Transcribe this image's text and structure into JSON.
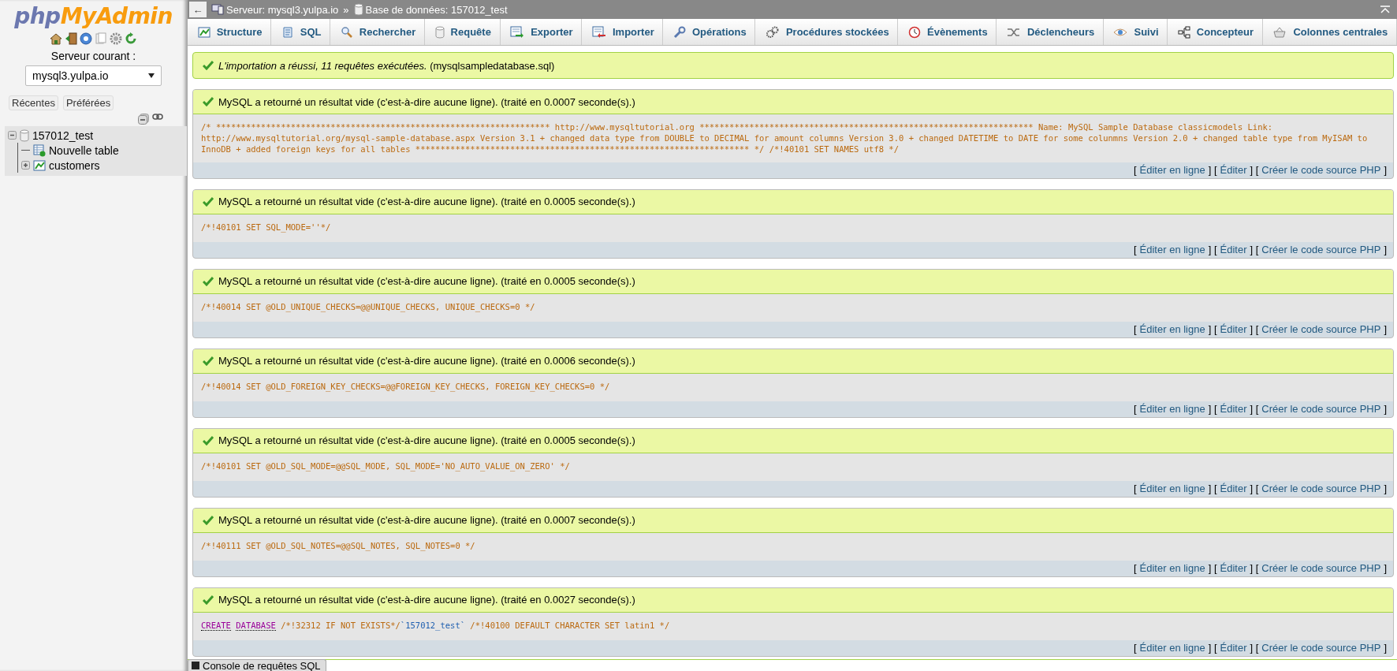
{
  "sidebar": {
    "logo": {
      "prefix": "php",
      "suffix": "MyAdmin"
    },
    "server_label": "Serveur courant :",
    "server_select": {
      "value": "mysql3.yulpa.io"
    },
    "buttons": [
      "Récentes",
      "Préférées"
    ],
    "tree": [
      {
        "label": "157012_test",
        "kind": "database",
        "expanded": true,
        "children": [
          {
            "label": "Nouvelle table",
            "kind": "new"
          },
          {
            "label": "customers",
            "kind": "table",
            "expanded": false
          }
        ]
      }
    ]
  },
  "back_button": "←",
  "breadcrumb": [
    {
      "kind": "server",
      "text": "Serveur: mysql3.yulpa.io"
    },
    {
      "kind": "separator",
      "text": "»"
    },
    {
      "kind": "database",
      "text": "Base de données: 157012_test"
    }
  ],
  "tabs": [
    {
      "label": "Structure",
      "selected": false
    },
    {
      "label": "SQL",
      "selected": false
    },
    {
      "label": "Rechercher",
      "selected": false
    },
    {
      "label": "Requête",
      "selected": false
    },
    {
      "label": "Exporter",
      "selected": false
    },
    {
      "label": "Importer",
      "selected": false
    },
    {
      "label": "Opérations",
      "selected": false
    },
    {
      "label": "Procédures stockées",
      "selected": false
    },
    {
      "label": "Évènements",
      "selected": false
    },
    {
      "label": "Déclencheurs",
      "selected": false
    },
    {
      "label": "Suivi",
      "selected": false
    },
    {
      "label": "Concepteur",
      "selected": false
    },
    {
      "label": "Colonnes centrales",
      "selected": false
    }
  ],
  "import_message": "*L'importation a réussi, 11 requêtes exécutées.* (mysqlsampledatabase.sql)",
  "results": [
    {
      "message": "MySQL a retourné un résultat vide (c'est-à-dire aucune ligne). (traité en 0.0007 seconde(s).)",
      "query": [
        {
          "kind": "comment",
          "text": "/* ******************************************************************* http://www.mysqltutorial.org ******************************************************************* Name: MySQL Sample Database classicmodels Link: http://www.mysqltutorial.org/mysql-sample-database.aspx Version 3.1 + changed data type from DOUBLE to DECIMAL for amount columns Version 3.0 + changed DATETIME to DATE for some colunmns Version 2.0 + changed table type from MyISAM to InnoDB + added foreign keys for all tables ******************************************************************* */ /*!40101 SET NAMES utf8 */"
        }
      ],
      "links": [
        {
          "kind": "bracket",
          "text": "["
        },
        {
          "kind": "link",
          "text": "Éditer en ligne"
        },
        {
          "kind": "bracket",
          "text": "] ["
        },
        {
          "kind": "link",
          "text": "Éditer"
        },
        {
          "kind": "bracket",
          "text": "] ["
        },
        {
          "kind": "link",
          "text": "Créer le code source PHP"
        },
        {
          "kind": "bracket",
          "text": "]"
        }
      ]
    },
    {
      "message": "MySQL a retourné un résultat vide (c'est-à-dire aucune ligne). (traité en 0.0005 seconde(s).)",
      "query": [
        {
          "kind": "comment",
          "text": "/*!40101 SET SQL_MODE=''*/"
        }
      ],
      "links": [
        {
          "kind": "bracket",
          "text": "["
        },
        {
          "kind": "link",
          "text": "Éditer en ligne"
        },
        {
          "kind": "bracket",
          "text": "] ["
        },
        {
          "kind": "link",
          "text": "Éditer"
        },
        {
          "kind": "bracket",
          "text": "] ["
        },
        {
          "kind": "link",
          "text": "Créer le code source PHP"
        },
        {
          "kind": "bracket",
          "text": "]"
        }
      ]
    },
    {
      "message": "MySQL a retourné un résultat vide (c'est-à-dire aucune ligne). (traité en 0.0005 seconde(s).)",
      "query": [
        {
          "kind": "comment",
          "text": "/*!40014 SET @OLD_UNIQUE_CHECKS=@@UNIQUE_CHECKS, UNIQUE_CHECKS=0 */"
        }
      ],
      "links": [
        {
          "kind": "bracket",
          "text": "["
        },
        {
          "kind": "link",
          "text": "Éditer en ligne"
        },
        {
          "kind": "bracket",
          "text": "] ["
        },
        {
          "kind": "link",
          "text": "Éditer"
        },
        {
          "kind": "bracket",
          "text": "] ["
        },
        {
          "kind": "link",
          "text": "Créer le code source PHP"
        },
        {
          "kind": "bracket",
          "text": "]"
        }
      ]
    },
    {
      "message": "MySQL a retourné un résultat vide (c'est-à-dire aucune ligne). (traité en 0.0006 seconde(s).)",
      "query": [
        {
          "kind": "comment",
          "text": "/*!40014 SET @OLD_FOREIGN_KEY_CHECKS=@@FOREIGN_KEY_CHECKS, FOREIGN_KEY_CHECKS=0 */"
        }
      ],
      "links": [
        {
          "kind": "bracket",
          "text": "["
        },
        {
          "kind": "link",
          "text": "Éditer en ligne"
        },
        {
          "kind": "bracket",
          "text": "] ["
        },
        {
          "kind": "link",
          "text": "Éditer"
        },
        {
          "kind": "bracket",
          "text": "] ["
        },
        {
          "kind": "link",
          "text": "Créer le code source PHP"
        },
        {
          "kind": "bracket",
          "text": "]"
        }
      ]
    },
    {
      "message": "MySQL a retourné un résultat vide (c'est-à-dire aucune ligne). (traité en 0.0005 seconde(s).)",
      "query": [
        {
          "kind": "comment",
          "text": "/*!40101 SET @OLD_SQL_MODE=@@SQL_MODE, SQL_MODE='NO_AUTO_VALUE_ON_ZERO' */"
        }
      ],
      "links": [
        {
          "kind": "bracket",
          "text": "["
        },
        {
          "kind": "link",
          "text": "Éditer en ligne"
        },
        {
          "kind": "bracket",
          "text": "] ["
        },
        {
          "kind": "link",
          "text": "Éditer"
        },
        {
          "kind": "bracket",
          "text": "] ["
        },
        {
          "kind": "link",
          "text": "Créer le code source PHP"
        },
        {
          "kind": "bracket",
          "text": "]"
        }
      ]
    },
    {
      "message": "MySQL a retourné un résultat vide (c'est-à-dire aucune ligne). (traité en 0.0007 seconde(s).)",
      "query": [
        {
          "kind": "comment",
          "text": "/*!40111 SET @OLD_SQL_NOTES=@@SQL_NOTES, SQL_NOTES=0 */"
        }
      ],
      "links": [
        {
          "kind": "bracket",
          "text": "["
        },
        {
          "kind": "link",
          "text": "Éditer en ligne"
        },
        {
          "kind": "bracket",
          "text": "] ["
        },
        {
          "kind": "link",
          "text": "Éditer"
        },
        {
          "kind": "bracket",
          "text": "] ["
        },
        {
          "kind": "link",
          "text": "Créer le code source PHP"
        },
        {
          "kind": "bracket",
          "text": "]"
        }
      ]
    },
    {
      "message": "MySQL a retourné un résultat vide (c'est-à-dire aucune ligne). (traité en 0.0027 seconde(s).)",
      "query": [
        {
          "kind": "keyword",
          "text": "CREATE"
        },
        {
          "kind": "keyword",
          "text": "DATABASE"
        },
        {
          "kind": "comment",
          "text": " /*!32312 IF NOT EXISTS*/"
        },
        {
          "kind": "identifier",
          "text": "`157012_test`"
        },
        {
          "kind": "comment",
          "text": " /*!40100 DEFAULT CHARACTER SET latin1 */"
        }
      ],
      "links": [
        {
          "kind": "bracket",
          "text": "["
        },
        {
          "kind": "link",
          "text": "Éditer en ligne"
        },
        {
          "kind": "bracket",
          "text": "] ["
        },
        {
          "kind": "link",
          "text": "Éditer"
        },
        {
          "kind": "bracket",
          "text": "] ["
        },
        {
          "kind": "link",
          "text": "Créer le code source PHP"
        },
        {
          "kind": "bracket",
          "text": "]"
        }
      ]
    }
  ],
  "console": {
    "label": "Console de requêtes SQL"
  }
}
